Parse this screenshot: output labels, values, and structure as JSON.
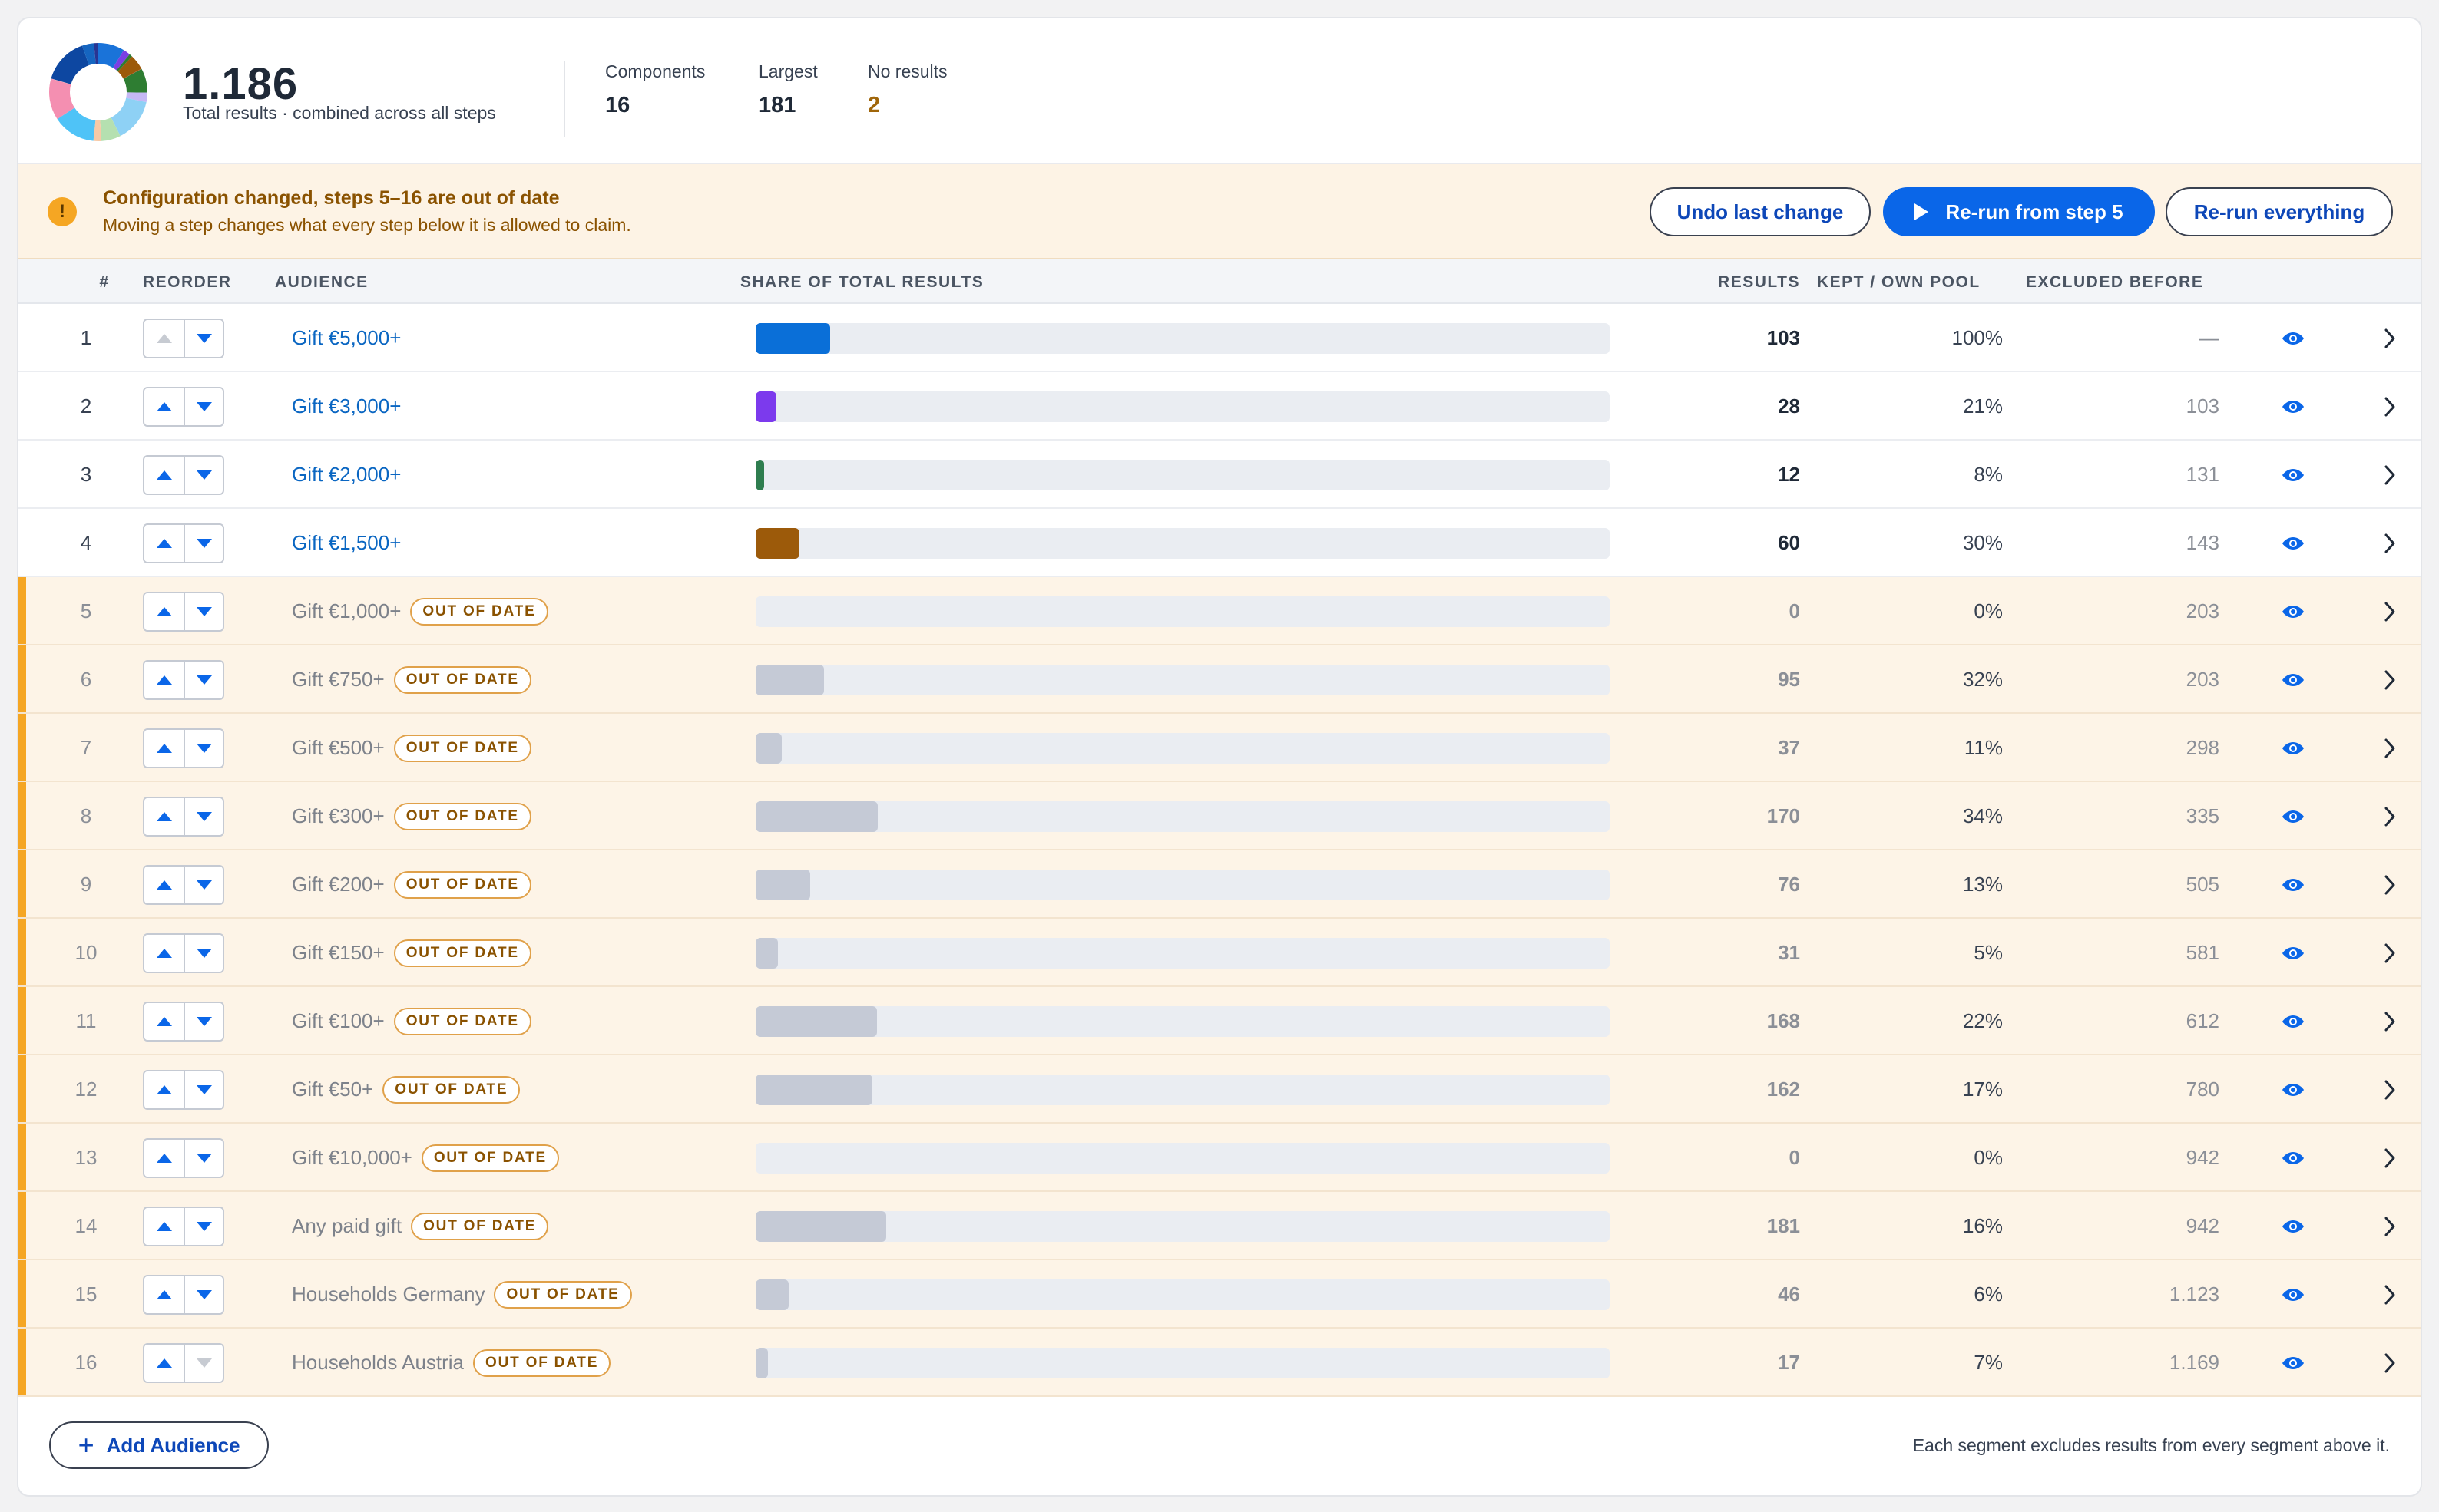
{
  "summary": {
    "total": "1.186",
    "total_caption": "Total results · combined across all steps",
    "metrics": [
      {
        "label": "Components",
        "value": "16"
      },
      {
        "label": "Largest",
        "value": "181"
      },
      {
        "label": "No results",
        "value": "2"
      }
    ],
    "donut_colors": [
      "#1a73d9",
      "#7b3fe4",
      "#2e7d32",
      "#9c5a0a",
      "#e53935",
      "#2e7d32",
      "#c5b8f5",
      "#8ed1f5",
      "#b5e0b0",
      "#f7c9a6",
      "#4fc3f7",
      "#f48fb1",
      "#f5b7b1",
      "#0d47a1",
      "#1565c0",
      "#283593"
    ],
    "donut_values": [
      103,
      28,
      12,
      60,
      1,
      95,
      37,
      170,
      76,
      31,
      168,
      162,
      1,
      181,
      46,
      17
    ]
  },
  "banner": {
    "title": "Configuration changed, steps 5–16 are out of date",
    "text": "Moving a step changes what every step below it is allowed to claim.",
    "undo_label": "Undo last change",
    "rerun_step_label": "Re-run from step 5",
    "rerun_all_label": "Re-run everything"
  },
  "table": {
    "headers": {
      "num": "#",
      "reorder": "REORDER",
      "audience": "AUDIENCE",
      "share": "SHARE OF TOTAL RESULTS",
      "results": "RESULTS",
      "kept": "KEPT / OWN POOL",
      "excluded": "EXCLUDED BEFORE"
    },
    "badge_label": "OUT OF DATE",
    "rows": [
      {
        "num": "1",
        "audience": "Gift €5,000+",
        "results": "103",
        "kept": "100%",
        "excluded": "—",
        "share": 0.087,
        "color": "#0a6fd8",
        "stale": false,
        "up_disabled": true,
        "down_disabled": false
      },
      {
        "num": "2",
        "audience": "Gift €3,000+",
        "results": "28",
        "kept": "21%",
        "excluded": "103",
        "share": 0.024,
        "color": "#7c3aed",
        "stale": false,
        "up_disabled": false,
        "down_disabled": false
      },
      {
        "num": "3",
        "audience": "Gift €2,000+",
        "results": "12",
        "kept": "8%",
        "excluded": "131",
        "share": 0.01,
        "color": "#2e7d4f",
        "stale": false,
        "up_disabled": false,
        "down_disabled": false
      },
      {
        "num": "4",
        "audience": "Gift €1,500+",
        "results": "60",
        "kept": "30%",
        "excluded": "143",
        "share": 0.051,
        "color": "#9c5a0a",
        "stale": false,
        "up_disabled": false,
        "down_disabled": false
      },
      {
        "num": "5",
        "audience": "Gift €1,000+",
        "results": "0",
        "kept": "0%",
        "excluded": "203",
        "share": 0,
        "color": "#c5cad6",
        "stale": true,
        "up_disabled": false,
        "down_disabled": false
      },
      {
        "num": "6",
        "audience": "Gift €750+",
        "results": "95",
        "kept": "32%",
        "excluded": "203",
        "share": 0.08,
        "color": "#c5cad6",
        "stale": true,
        "up_disabled": false,
        "down_disabled": false
      },
      {
        "num": "7",
        "audience": "Gift €500+",
        "results": "37",
        "kept": "11%",
        "excluded": "298",
        "share": 0.031,
        "color": "#c5cad6",
        "stale": true,
        "up_disabled": false,
        "down_disabled": false
      },
      {
        "num": "8",
        "audience": "Gift €300+",
        "results": "170",
        "kept": "34%",
        "excluded": "335",
        "share": 0.143,
        "color": "#c5cad6",
        "stale": true,
        "up_disabled": false,
        "down_disabled": false
      },
      {
        "num": "9",
        "audience": "Gift €200+",
        "results": "76",
        "kept": "13%",
        "excluded": "505",
        "share": 0.064,
        "color": "#c5cad6",
        "stale": true,
        "up_disabled": false,
        "down_disabled": false
      },
      {
        "num": "10",
        "audience": "Gift €150+",
        "results": "31",
        "kept": "5%",
        "excluded": "581",
        "share": 0.026,
        "color": "#c5cad6",
        "stale": true,
        "up_disabled": false,
        "down_disabled": false
      },
      {
        "num": "11",
        "audience": "Gift €100+",
        "results": "168",
        "kept": "22%",
        "excluded": "612",
        "share": 0.142,
        "color": "#c5cad6",
        "stale": true,
        "up_disabled": false,
        "down_disabled": false
      },
      {
        "num": "12",
        "audience": "Gift €50+",
        "results": "162",
        "kept": "17%",
        "excluded": "780",
        "share": 0.137,
        "color": "#c5cad6",
        "stale": true,
        "up_disabled": false,
        "down_disabled": false
      },
      {
        "num": "13",
        "audience": "Gift €10,000+",
        "results": "0",
        "kept": "0%",
        "excluded": "942",
        "share": 0,
        "color": "#c5cad6",
        "stale": true,
        "up_disabled": false,
        "down_disabled": false
      },
      {
        "num": "14",
        "audience": "Any paid gift",
        "results": "181",
        "kept": "16%",
        "excluded": "942",
        "share": 0.153,
        "color": "#c5cad6",
        "stale": true,
        "up_disabled": false,
        "down_disabled": false
      },
      {
        "num": "15",
        "audience": "Households Germany",
        "results": "46",
        "kept": "6%",
        "excluded": "1.123",
        "share": 0.039,
        "color": "#c5cad6",
        "stale": true,
        "up_disabled": false,
        "down_disabled": false
      },
      {
        "num": "16",
        "audience": "Households Austria",
        "results": "17",
        "kept": "7%",
        "excluded": "1.169",
        "share": 0.014,
        "color": "#c5cad6",
        "stale": true,
        "up_disabled": false,
        "down_disabled": true
      }
    ]
  },
  "footer": {
    "add_label": "Add Audience",
    "note": "Each segment excludes results from every segment above it."
  }
}
